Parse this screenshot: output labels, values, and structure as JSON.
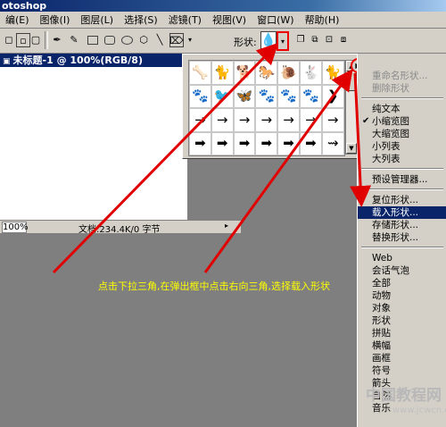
{
  "app": {
    "title": "otoshop"
  },
  "menubar": {
    "items": [
      "编(E)",
      "图像(I)",
      "图层(L)",
      "选择(S)",
      "滤镜(T)",
      "视图(V)",
      "窗口(W)",
      "帮助(H)"
    ]
  },
  "options": {
    "shape_label": "形状:"
  },
  "document": {
    "title": "未标题-1 @ 100%(RGB/8)",
    "zoom": "100%",
    "doc_info": "文档:234.4K/0 字节"
  },
  "shapes_grid": {
    "rows": [
      [
        "🦴",
        "🐈",
        "🐕",
        "🐎",
        "🐌",
        "🐇",
        "🐈"
      ],
      [
        "🐾",
        "🐦",
        "🦋",
        "🐾",
        "🐾",
        "🐾",
        "❯"
      ],
      [
        "→",
        "→",
        "→",
        "→",
        "→",
        "→",
        "→"
      ],
      [
        "➡",
        "➡",
        "➡",
        "➡",
        "➡",
        "➡",
        "⇝"
      ]
    ]
  },
  "context_menu": {
    "items": [
      {
        "label": "重命名形状...",
        "state": "disabled"
      },
      {
        "label": "删除形状",
        "state": "disabled"
      },
      {
        "label": "纯文本",
        "state": "normal"
      },
      {
        "label": "小缩览图",
        "state": "checked"
      },
      {
        "label": "大缩览图",
        "state": "normal"
      },
      {
        "label": "小列表",
        "state": "normal"
      },
      {
        "label": "大列表",
        "state": "normal"
      },
      {
        "label": "预设管理器...",
        "state": "normal"
      },
      {
        "label": "复位形状...",
        "state": "normal"
      },
      {
        "label": "载入形状...",
        "state": "selected"
      },
      {
        "label": "存储形状...",
        "state": "normal"
      },
      {
        "label": "替换形状...",
        "state": "normal"
      },
      {
        "label": "Web",
        "state": "normal"
      },
      {
        "label": "会话气泡",
        "state": "normal"
      },
      {
        "label": "全部",
        "state": "normal"
      },
      {
        "label": "动物",
        "state": "normal"
      },
      {
        "label": "对象",
        "state": "normal"
      },
      {
        "label": "形状",
        "state": "normal"
      },
      {
        "label": "拼贴",
        "state": "normal"
      },
      {
        "label": "横幅",
        "state": "normal"
      },
      {
        "label": "画框",
        "state": "normal"
      },
      {
        "label": "符号",
        "state": "normal"
      },
      {
        "label": "箭头",
        "state": "normal"
      },
      {
        "label": "自然",
        "state": "normal"
      },
      {
        "label": "音乐",
        "state": "normal"
      }
    ]
  },
  "annotation": {
    "caption": "点击下拉三角,在弹出框中点击右向三角,选择载入形状"
  },
  "watermark": {
    "text": "中国教程网",
    "url": "www.jcwcn.com"
  },
  "colors": {
    "annotation_red": "#e00000",
    "caption_yellow": "#ffff00",
    "menu_highlight": "#0a246a"
  }
}
